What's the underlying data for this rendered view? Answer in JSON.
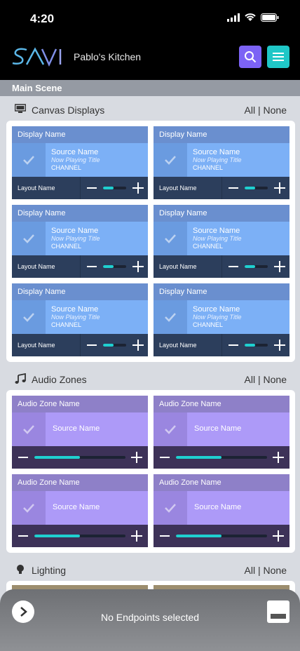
{
  "status": {
    "time": "4:20"
  },
  "header": {
    "title": "Pablo's Kitchen",
    "logo_text": "SAVI"
  },
  "scene": {
    "label": "Main Scene"
  },
  "canvas": {
    "title": "Canvas Displays",
    "all_none": "All | None",
    "tiles": [
      {
        "display": "Display Name",
        "source": "Source Name",
        "now_playing": "Now Playing Title",
        "channel": "CHANNEL",
        "layout": "Layout Name",
        "volume": 0.45
      },
      {
        "display": "Display Name",
        "source": "Source Name",
        "now_playing": "Now Playing Title",
        "channel": "CHANNEL",
        "layout": "Layout Name",
        "volume": 0.45
      },
      {
        "display": "Display Name",
        "source": "Source Name",
        "now_playing": "Now Playing Title",
        "channel": "CHANNEL",
        "layout": "Layout Name",
        "volume": 0.45
      },
      {
        "display": "Display Name",
        "source": "Source Name",
        "now_playing": "Now Playing Title",
        "channel": "CHANNEL",
        "layout": "Layout Name",
        "volume": 0.45
      },
      {
        "display": "Display Name",
        "source": "Source Name",
        "now_playing": "Now Playing Title",
        "channel": "CHANNEL",
        "layout": "Layout Name",
        "volume": 0.45
      },
      {
        "display": "Display Name",
        "source": "Source Name",
        "now_playing": "Now Playing Title",
        "channel": "CHANNEL",
        "layout": "Layout Name",
        "volume": 0.45
      }
    ]
  },
  "audio": {
    "title": "Audio Zones",
    "all_none": "All | None",
    "tiles": [
      {
        "zone": "Audio Zone Name",
        "source": "Source Name",
        "volume": 0.5
      },
      {
        "zone": "Audio Zone Name",
        "source": "Source Name",
        "volume": 0.5
      },
      {
        "zone": "Audio Zone Name",
        "source": "Source Name",
        "volume": 0.5
      },
      {
        "zone": "Audio Zone Name",
        "source": "Source Name",
        "volume": 0.5
      }
    ]
  },
  "lighting": {
    "title": "Lighting",
    "all_none": "All | None"
  },
  "bottom": {
    "message": "No Endpoints selected"
  },
  "colors": {
    "accent_purple": "#7c63f5",
    "accent_teal": "#1fc7c7",
    "display_blue": "#7cb0f6",
    "audio_purple": "#ad9af8"
  }
}
